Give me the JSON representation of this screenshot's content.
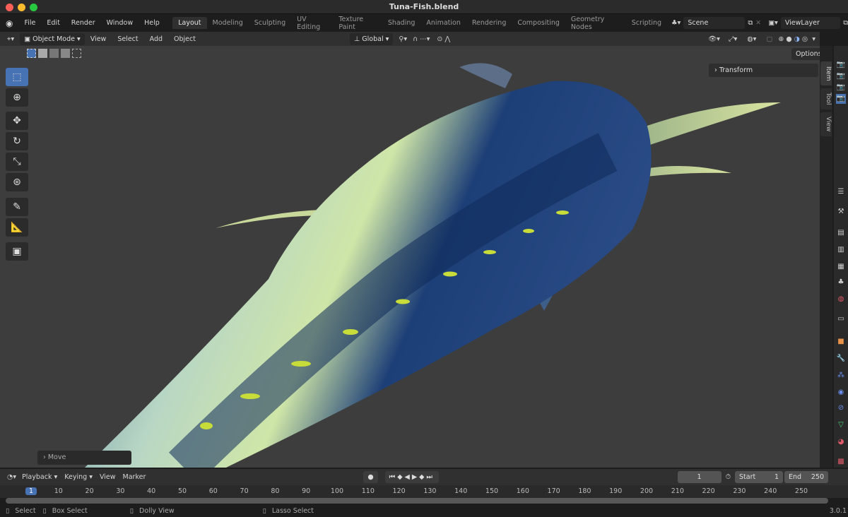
{
  "window": {
    "title": "Tuna-Fish.blend"
  },
  "menu": [
    "File",
    "Edit",
    "Render",
    "Window",
    "Help"
  ],
  "workspaces": [
    "Layout",
    "Modeling",
    "Sculpting",
    "UV Editing",
    "Texture Paint",
    "Shading",
    "Animation",
    "Rendering",
    "Compositing",
    "Geometry Nodes",
    "Scripting"
  ],
  "active_workspace": "Layout",
  "scene": "Scene",
  "view_layer": "ViewLayer",
  "header": {
    "mode": "Object Mode",
    "menus": [
      "View",
      "Select",
      "Add",
      "Object"
    ],
    "orientation": "Global",
    "options": "Options"
  },
  "sidebar": {
    "panel": "Transform",
    "tabs": [
      "Item",
      "Tool",
      "View"
    ]
  },
  "operator_panel": "Move",
  "timeline": {
    "menus": [
      "Playback",
      "Keying",
      "View",
      "Marker"
    ],
    "current_frame": "1",
    "start_label": "Start",
    "start": "1",
    "end_label": "End",
    "end": "250",
    "ticks": [
      "1",
      "10",
      "20",
      "30",
      "40",
      "50",
      "60",
      "70",
      "80",
      "90",
      "100",
      "110",
      "120",
      "130",
      "140",
      "150",
      "160",
      "170",
      "180",
      "190",
      "200",
      "210",
      "220",
      "230",
      "240",
      "250"
    ]
  },
  "status": {
    "items": [
      "Select",
      "Box Select",
      "Dolly View",
      "Lasso Select"
    ],
    "version": "3.0.1"
  },
  "colors": {
    "accent": "#4772b3",
    "viewport": "#3d3d3d"
  }
}
